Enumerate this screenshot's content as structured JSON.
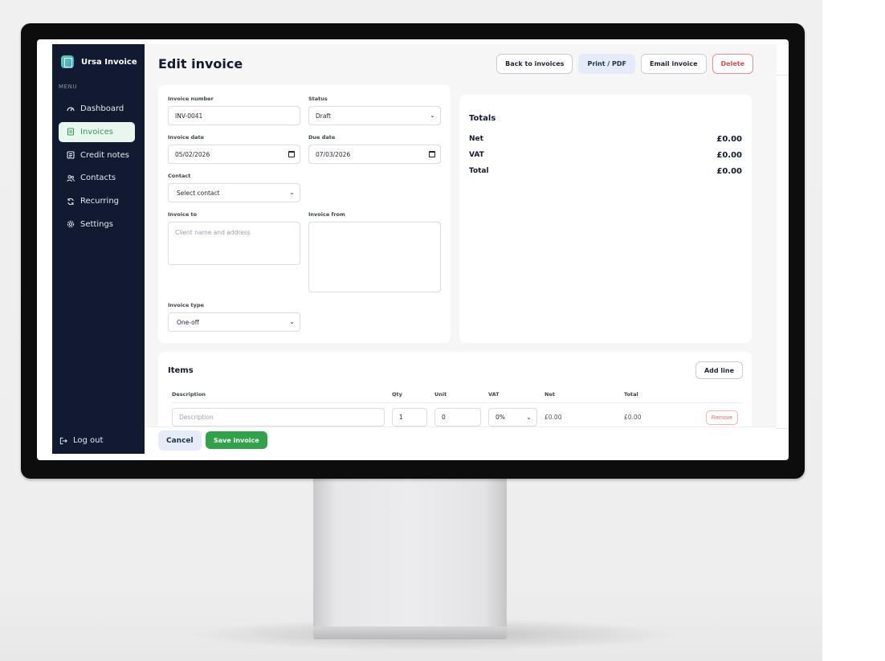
{
  "app": {
    "brand_name": "Ursa Invoice",
    "menu_label": "MENU"
  },
  "sidebar": {
    "items": [
      {
        "label": "Dashboard",
        "icon": "gauge-icon",
        "active": false
      },
      {
        "label": "Invoices",
        "icon": "document-icon",
        "active": true
      },
      {
        "label": "Credit notes",
        "icon": "ledger-icon",
        "active": false
      },
      {
        "label": "Contacts",
        "icon": "users-icon",
        "active": false
      },
      {
        "label": "Recurring",
        "icon": "refresh-icon",
        "active": false
      },
      {
        "label": "Settings",
        "icon": "gear-icon",
        "active": false
      }
    ],
    "logout_label": "Log out"
  },
  "header": {
    "title": "Edit invoice",
    "back_label": "Back to invoices",
    "print_label": "Print / PDF",
    "email_label": "Email invoice",
    "delete_label": "Delete"
  },
  "form": {
    "invoice_number": {
      "label": "Invoice number",
      "value": "INV-0041"
    },
    "status": {
      "label": "Status",
      "value": "Draft"
    },
    "invoice_date": {
      "label": "Invoice date",
      "value": "05/02/2026"
    },
    "due_date": {
      "label": "Due date",
      "value": "07/03/2026"
    },
    "contact": {
      "label": "Contact",
      "value": "Select contact"
    },
    "invoice_to": {
      "label": "Invoice to",
      "placeholder": "Client name and address"
    },
    "invoice_from": {
      "label": "Invoice from",
      "value": ""
    },
    "invoice_type": {
      "label": "Invoice type",
      "value": "One-off"
    }
  },
  "totals": {
    "title": "Totals",
    "net_label": "Net",
    "net_value": "£0.00",
    "vat_label": "VAT",
    "vat_value": "£0.00",
    "total_label": "Total",
    "total_value": "£0.00"
  },
  "items": {
    "title": "Items",
    "add_line_label": "Add line",
    "columns": {
      "description": "Description",
      "qty": "Qty",
      "unit": "Unit",
      "vat": "VAT",
      "net": "Net",
      "total": "Total"
    },
    "row": {
      "description_placeholder": "Description",
      "qty": "1",
      "unit": "0",
      "vat": "0%",
      "net": "£0.00",
      "total": "£0.00",
      "remove_label": "Remove"
    }
  },
  "footer": {
    "cancel_label": "Cancel",
    "save_label": "Save invoice"
  },
  "colors": {
    "sidebar": "#111a30",
    "accent_green": "#2fa24a",
    "danger": "#e24b4b",
    "soft_blue": "#e5ebf8"
  }
}
